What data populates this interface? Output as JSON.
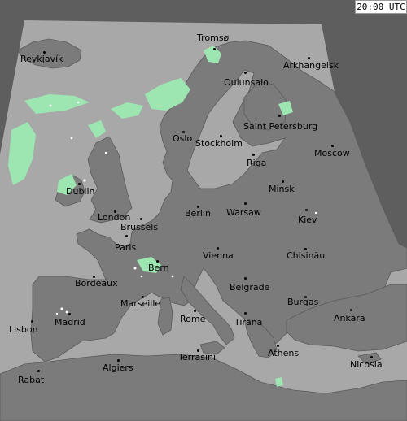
{
  "time_label": "20:00 UTC",
  "colors": {
    "outside": "#5e5e5e",
    "sea": "#a8a8a8",
    "land": "#7b7b7b",
    "border": "#5a5a5a",
    "precip": "#9de6b2",
    "precip_light": "#ffffff"
  },
  "cities": [
    {
      "id": "tromso",
      "name": "Tromsø"
    },
    {
      "id": "reykjavik",
      "name": "Reykjavík"
    },
    {
      "id": "arkhangelsk",
      "name": "Arkhangelsk"
    },
    {
      "id": "oulunsalo",
      "name": "Oulunsalo"
    },
    {
      "id": "saint-petersburg",
      "name": "Saint Petersburg"
    },
    {
      "id": "oslo",
      "name": "Oslo"
    },
    {
      "id": "stockholm",
      "name": "Stockholm"
    },
    {
      "id": "moscow",
      "name": "Moscow"
    },
    {
      "id": "riga",
      "name": "Riga"
    },
    {
      "id": "dublin",
      "name": "Dublin"
    },
    {
      "id": "minsk",
      "name": "Minsk"
    },
    {
      "id": "london",
      "name": "London"
    },
    {
      "id": "berlin",
      "name": "Berlin"
    },
    {
      "id": "warsaw",
      "name": "Warsaw"
    },
    {
      "id": "kiev",
      "name": "Kiev"
    },
    {
      "id": "brussels",
      "name": "Brussels"
    },
    {
      "id": "paris",
      "name": "Paris"
    },
    {
      "id": "vienna",
      "name": "Vienna"
    },
    {
      "id": "chisinau",
      "name": "Chisinău"
    },
    {
      "id": "bern",
      "name": "Bern"
    },
    {
      "id": "bordeaux",
      "name": "Bordeaux"
    },
    {
      "id": "belgrade",
      "name": "Belgrade"
    },
    {
      "id": "marseille",
      "name": "Marseille"
    },
    {
      "id": "burgas",
      "name": "Burgas"
    },
    {
      "id": "ankara",
      "name": "Ankara"
    },
    {
      "id": "madrid",
      "name": "Madrid"
    },
    {
      "id": "rome",
      "name": "Rome"
    },
    {
      "id": "tirana",
      "name": "Tirana"
    },
    {
      "id": "lisbon",
      "name": "Lisbon"
    },
    {
      "id": "athens",
      "name": "Athens"
    },
    {
      "id": "terrasini",
      "name": "Terrasini"
    },
    {
      "id": "nicosia",
      "name": "Nicosia"
    },
    {
      "id": "algiers",
      "name": "Algiers"
    },
    {
      "id": "rabat",
      "name": "Rabat"
    }
  ]
}
